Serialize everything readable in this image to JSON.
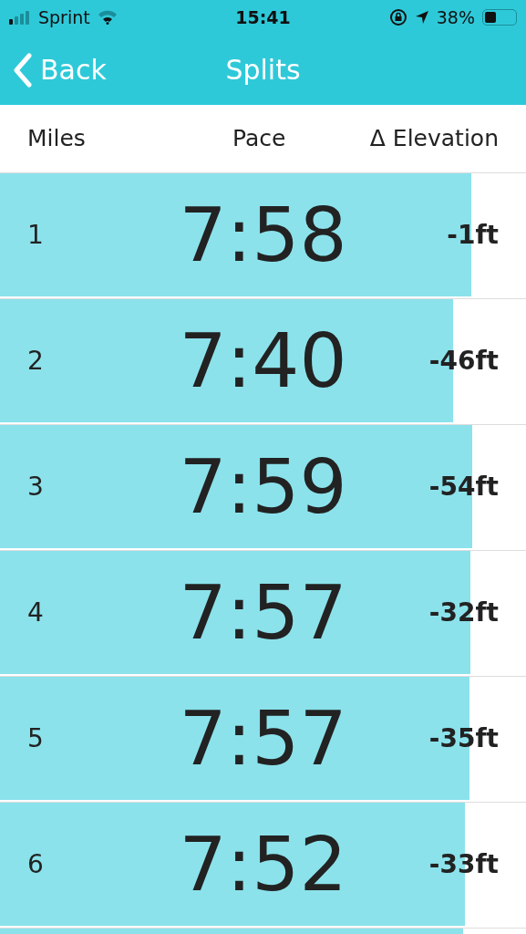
{
  "status_bar": {
    "carrier": "Sprint",
    "time": "15:41",
    "battery": "38%"
  },
  "nav": {
    "back": "Back",
    "title": "Splits"
  },
  "columns": [
    "Miles",
    "Pace",
    "Δ Elevation"
  ],
  "rows": [
    {
      "mile": "1",
      "pace": "7:58",
      "elevation": "-1ft",
      "level": 0.896
    },
    {
      "mile": "2",
      "pace": "7:40",
      "elevation": "-46ft",
      "level": 0.861
    },
    {
      "mile": "3",
      "pace": "7:59",
      "elevation": "-54ft",
      "level": 0.898
    },
    {
      "mile": "4",
      "pace": "7:57",
      "elevation": "-32ft",
      "level": 0.894
    },
    {
      "mile": "5",
      "pace": "7:57",
      "elevation": "-35ft",
      "level": 0.893
    },
    {
      "mile": "6",
      "pace": "7:52",
      "elevation": "-33ft",
      "level": 0.884
    },
    {
      "level": 0.88
    }
  ]
}
